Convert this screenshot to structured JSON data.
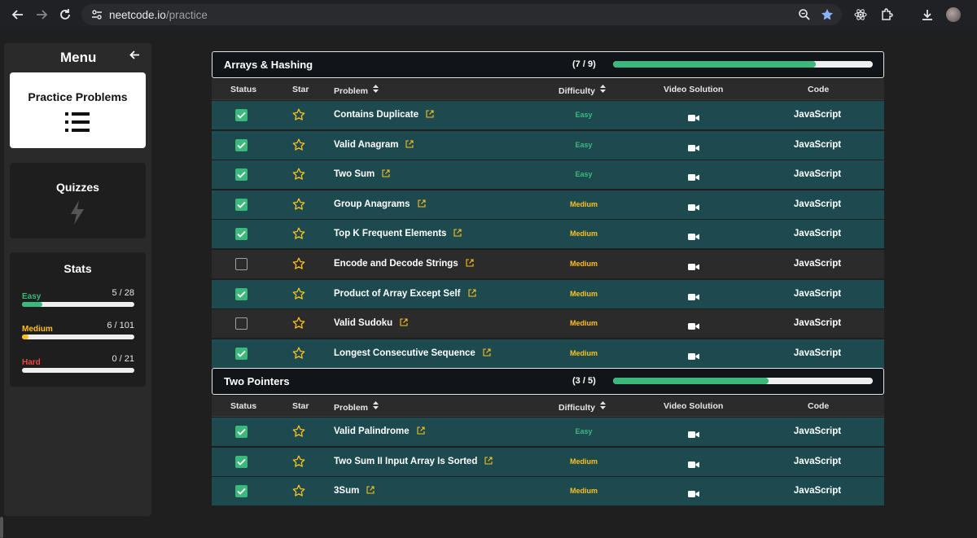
{
  "browser": {
    "url_domain": "neetcode.io",
    "url_path": "/practice"
  },
  "sidebar": {
    "title": "Menu",
    "practice_label": "Practice Problems",
    "quizzes_label": "Quizzes",
    "stats": {
      "title": "Stats",
      "items": [
        {
          "name": "Easy",
          "count": "5 / 28",
          "color": "#3bb97d",
          "fraction": 0.18
        },
        {
          "name": "Medium",
          "count": "6 / 101",
          "color": "#ffc01e",
          "fraction": 0.06
        },
        {
          "name": "Hard",
          "count": "0 / 21",
          "color": "#ef4743",
          "fraction": 0
        }
      ]
    }
  },
  "table_headers": {
    "status": "Status",
    "star": "Star",
    "problem": "Problem",
    "difficulty": "Difficulty",
    "video": "Video Solution",
    "code": "Code"
  },
  "sections": [
    {
      "title": "Arrays & Hashing",
      "count": "(7 / 9)",
      "progress": 0.78,
      "rows": [
        {
          "done": true,
          "name": "Contains Duplicate",
          "difficulty": "Easy",
          "code": "JavaScript"
        },
        {
          "done": true,
          "name": "Valid Anagram",
          "difficulty": "Easy",
          "code": "JavaScript"
        },
        {
          "done": true,
          "name": "Two Sum",
          "difficulty": "Easy",
          "code": "JavaScript"
        },
        {
          "done": true,
          "name": "Group Anagrams",
          "difficulty": "Medium",
          "code": "JavaScript"
        },
        {
          "done": true,
          "name": "Top K Frequent Elements",
          "difficulty": "Medium",
          "code": "JavaScript"
        },
        {
          "done": false,
          "name": "Encode and Decode Strings",
          "difficulty": "Medium",
          "code": "JavaScript"
        },
        {
          "done": true,
          "name": "Product of Array Except Self",
          "difficulty": "Medium",
          "code": "JavaScript"
        },
        {
          "done": false,
          "name": "Valid Sudoku",
          "difficulty": "Medium",
          "code": "JavaScript"
        },
        {
          "done": true,
          "name": "Longest Consecutive Sequence",
          "difficulty": "Medium",
          "code": "JavaScript"
        }
      ]
    },
    {
      "title": "Two Pointers",
      "count": "(3 / 5)",
      "progress": 0.6,
      "rows": [
        {
          "done": true,
          "name": "Valid Palindrome",
          "difficulty": "Easy",
          "code": "JavaScript"
        },
        {
          "done": true,
          "name": "Two Sum II Input Array Is Sorted",
          "difficulty": "Medium",
          "code": "JavaScript"
        },
        {
          "done": true,
          "name": "3Sum",
          "difficulty": "Medium",
          "code": "JavaScript"
        }
      ]
    }
  ],
  "colors": {
    "accent_green": "#3bb97d",
    "medium_yellow": "#ffc01e",
    "hard_red": "#ef4743",
    "done_row": "#1c4a4e"
  }
}
